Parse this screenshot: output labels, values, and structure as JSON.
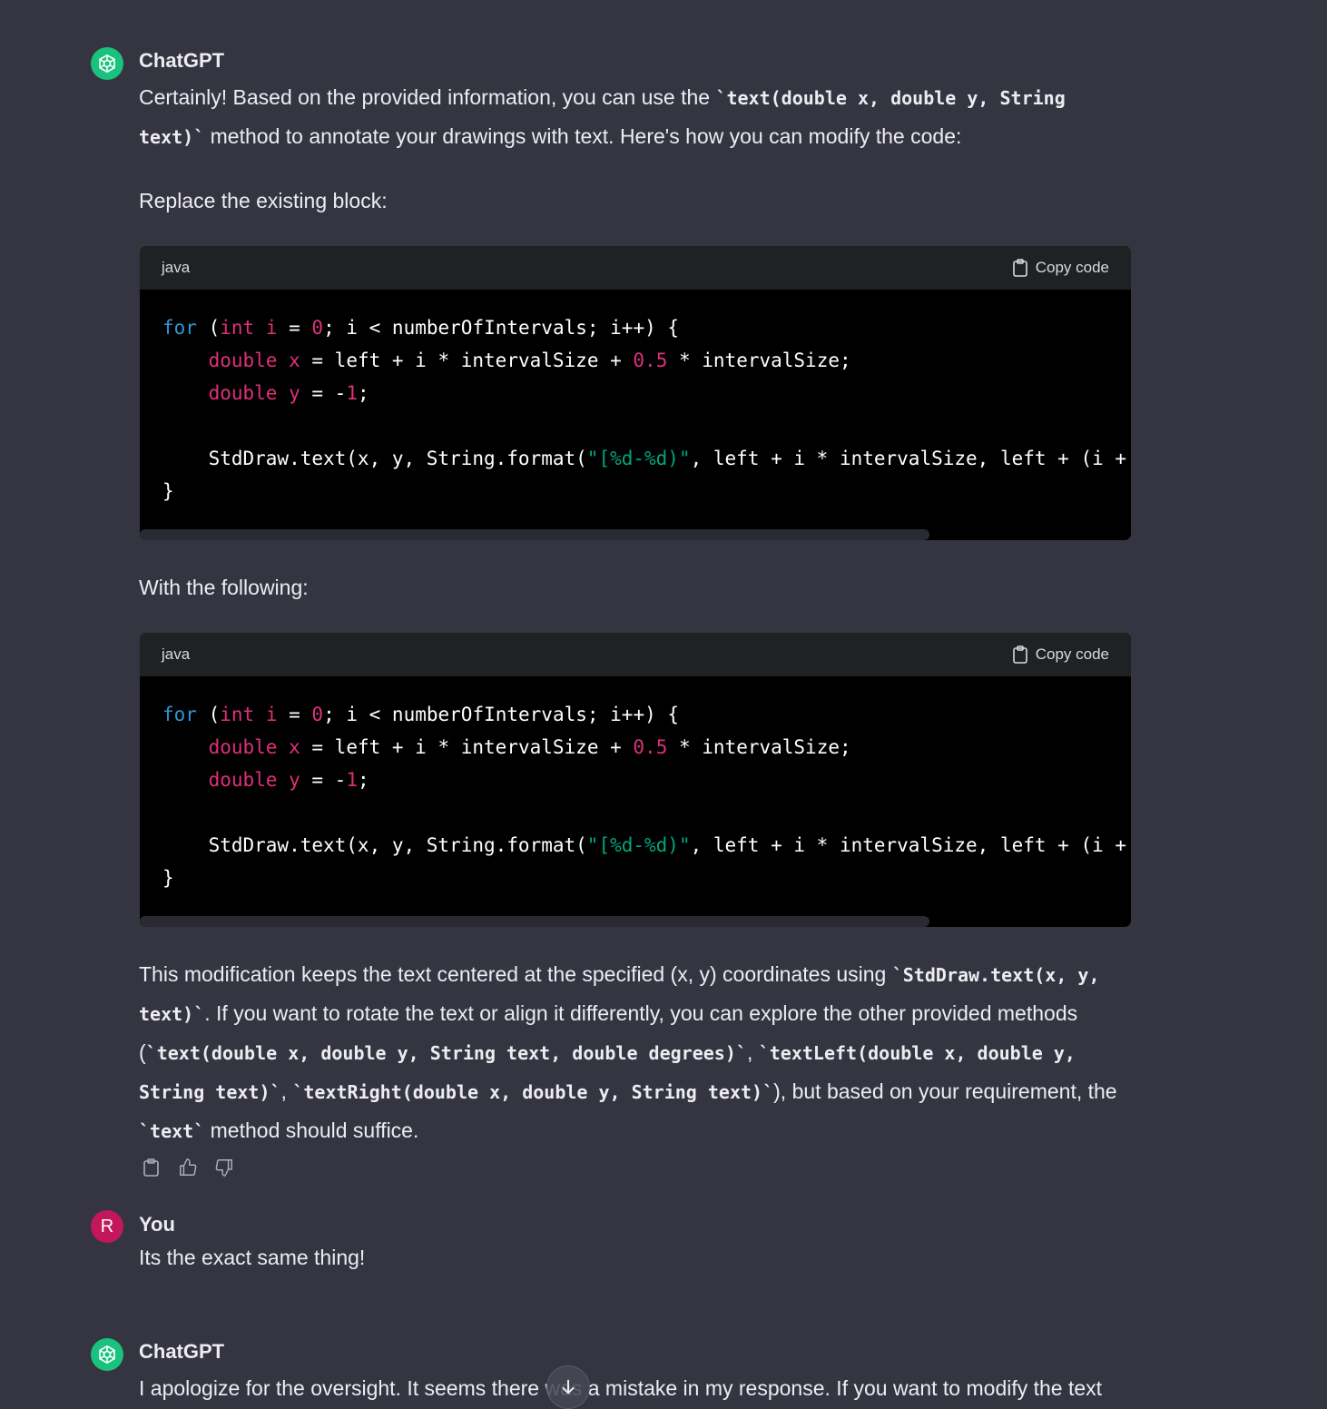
{
  "messages": {
    "m1": {
      "author": "ChatGPT",
      "intro_a": "Certainly! Based on the provided information, you can use the ",
      "intro_code": "`text(double x, double y, String text)`",
      "intro_b": " method to annotate your drawings with text. Here's how you can modify the code:",
      "replace_label": "Replace the existing block:",
      "with_label": "With the following:",
      "code_block_1": {
        "language": "java",
        "copy_label": "Copy code"
      },
      "code_block_2": {
        "language": "java",
        "copy_label": "Copy code"
      },
      "code_lines": {
        "l1": {
          "for": "for",
          "p1": " (",
          "int": "int",
          "i": "i",
          "p2": " = ",
          "zero": "0",
          "p3": "; i < numberOfIntervals; i++) {"
        },
        "l2": {
          "indent": "    ",
          "double": "double",
          "x": "x",
          "p1": " = left + i * intervalSize + ",
          "num": "0.5",
          "p2": " * intervalSize;"
        },
        "l3": {
          "indent": "    ",
          "double": "double",
          "y": "y",
          "p1": " = -",
          "num": "1",
          "p2": ";"
        },
        "l5": {
          "p1": "    StdDraw.text(x, y, String.format(",
          "str": "\"[%d-%d)\"",
          "p2": ", left + i * intervalSize, left + (i + "
        },
        "l6": "}"
      },
      "outro": {
        "t1": "This modification keeps the text centered at the specified (x, y) coordinates using ",
        "c1": "`StdDraw.text(x, y, text)`",
        "t2": ". If you want to rotate the text or align it differently, you can explore the other provided methods (",
        "c2": "`text(double x, double y, String text, double degrees)`",
        "t3": ", ",
        "c3": "`textLeft(double x, double y, String text)`",
        "t4": ", ",
        "c4": "`textRight(double x, double y, String text)`",
        "t5": "), but based on your requirement, the ",
        "c5": "`text`",
        "t6": " method should suffice."
      },
      "actions": [
        "copy-icon",
        "thumbs-up-icon",
        "thumbs-down-icon"
      ]
    },
    "m2": {
      "author": "You",
      "avatar_letter": "R",
      "text": "Its the exact same thing!"
    },
    "m3": {
      "author": "ChatGPT",
      "text": "I apologize for the oversight. It seems there was a mistake in my response. If you want to modify the text"
    }
  },
  "colors": {
    "background": "#343541",
    "gpt_avatar": "#19c37d",
    "user_avatar": "#c2185b",
    "keyword_blue": "#2e95d3",
    "keyword_pink": "#df3079",
    "string_green": "#00a67d"
  },
  "scroll_button": {
    "icon": "arrow-down-icon"
  }
}
